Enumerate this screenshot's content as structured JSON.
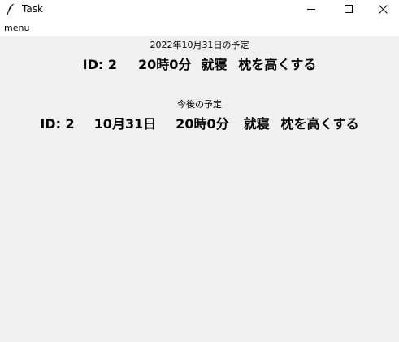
{
  "window": {
    "title": "Task",
    "icon": "feather-icon"
  },
  "menubar": {
    "items": [
      {
        "label": "menu"
      }
    ]
  },
  "today": {
    "heading": "2022年10月31日の予定",
    "task": {
      "id_label": "ID: 2",
      "time": "20時0分",
      "category": "就寝",
      "description": "枕を高くする"
    }
  },
  "upcoming": {
    "heading": "今後の予定",
    "task": {
      "id_label": "ID: 2",
      "date": "10月31日",
      "time": "20時0分",
      "category": "就寝",
      "description": "枕を高くする"
    }
  }
}
